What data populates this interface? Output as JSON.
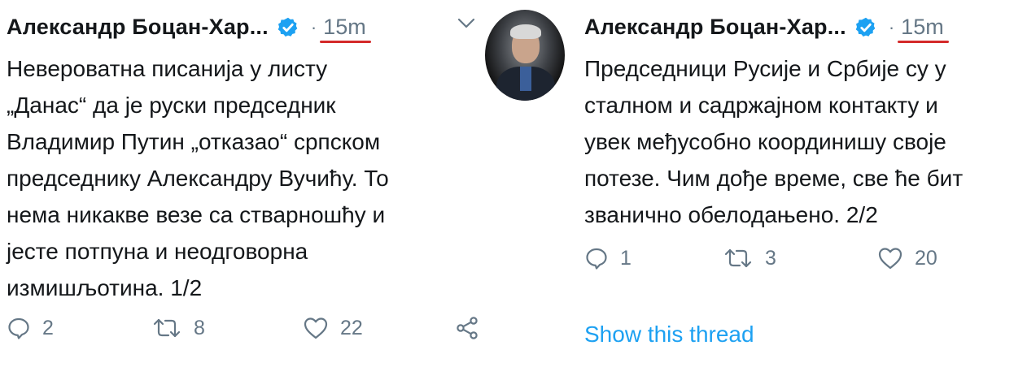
{
  "left_tweet": {
    "author": "Александр Боцан-Хар...",
    "time": "15m",
    "text": "Невероватна писанија у листу\n„Данас“ да је руски председник\nВладимир Путин „отказао“ српском\nпредседнику Александру Вучићу. То\nнема никакве везе са стварношћу и\nјесте потпуна и неодговорна\nизмишљотина. 1/2",
    "replies": "2",
    "retweets": "8",
    "likes": "22"
  },
  "right_tweet": {
    "author": "Александр Боцан-Хар...",
    "time": "15m",
    "text": "Председници Русије и Србије су у\nсталном и садржајном контакту и\nувек међусобно координишу своје\nпотезе. Чим дође време, све ће бит\nзванично обелодањено. 2/2",
    "replies": "1",
    "retweets": "3",
    "likes": "20",
    "show_thread": "Show this thread"
  },
  "colors": {
    "verified": "#1da1f2",
    "muted": "#657786",
    "link": "#1da1f2",
    "underline": "#d42a2a"
  }
}
